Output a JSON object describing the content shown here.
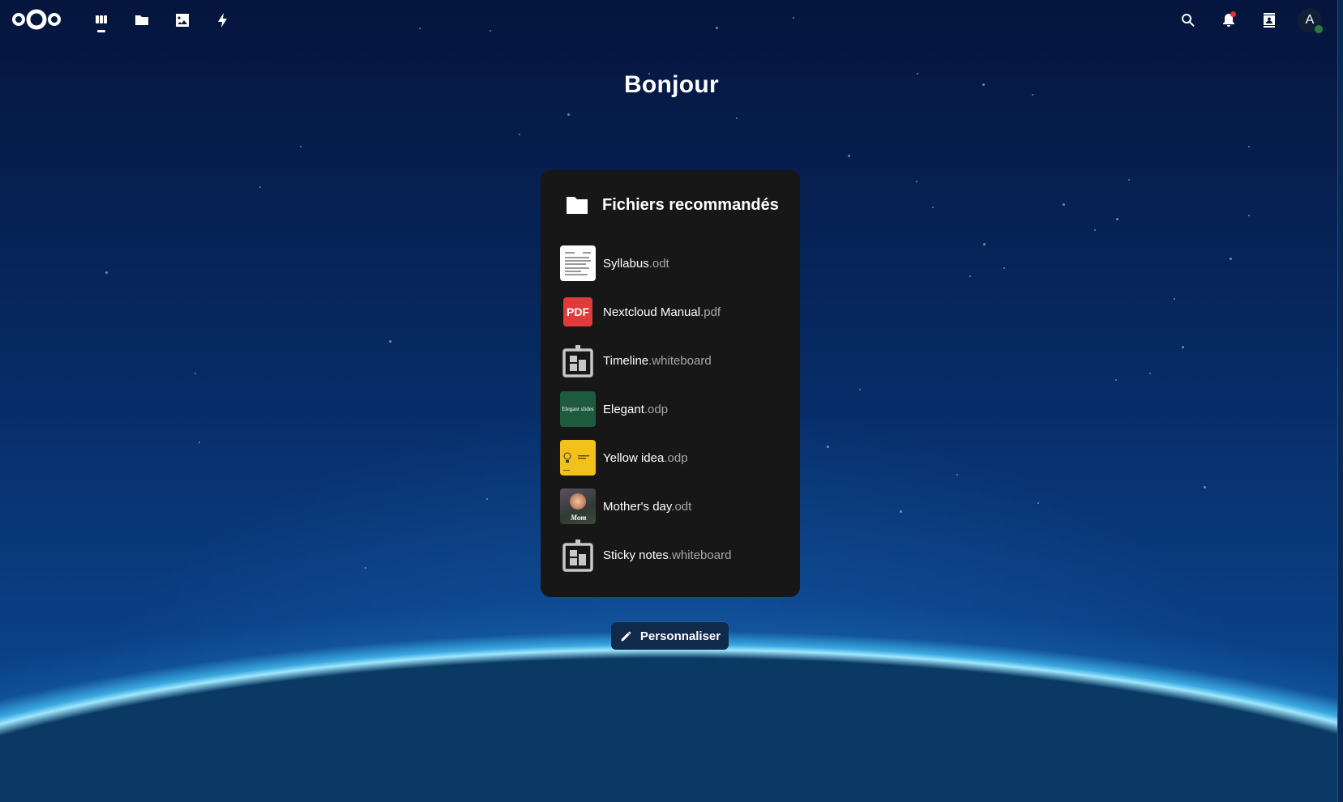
{
  "header": {
    "logo_icon": "nextcloud-logo",
    "apps": [
      {
        "name": "dashboard",
        "icon": "dashboard-icon",
        "active": true
      },
      {
        "name": "files",
        "icon": "folder-icon",
        "active": false
      },
      {
        "name": "photos",
        "icon": "image-icon",
        "active": false
      },
      {
        "name": "activity",
        "icon": "lightning-icon",
        "active": false
      }
    ],
    "right_icons": [
      "search-icon",
      "bell-icon",
      "contacts-icon"
    ],
    "avatar_initial": "A",
    "status_color": "#2d7b41",
    "notification_dot_color": "#e9322d"
  },
  "greeting": "Bonjour",
  "widget": {
    "title": "Fichiers recommandés",
    "icon": "folder-icon",
    "files": [
      {
        "name": "Syllabus",
        "ext": ".odt"
      },
      {
        "name": "Nextcloud Manual",
        "ext": ".pdf",
        "thumb_text": "PDF"
      },
      {
        "name": "Timeline",
        "ext": ".whiteboard"
      },
      {
        "name": "Elegant",
        "ext": ".odp",
        "thumb_text": "Elegant slides"
      },
      {
        "name": "Yellow idea",
        "ext": ".odp"
      },
      {
        "name": "Mother's day",
        "ext": ".odt",
        "thumb_text": "Mom"
      },
      {
        "name": "Sticky notes",
        "ext": ".whiteboard"
      }
    ]
  },
  "customize_button": {
    "label": "Personnaliser",
    "icon": "pencil-icon"
  }
}
